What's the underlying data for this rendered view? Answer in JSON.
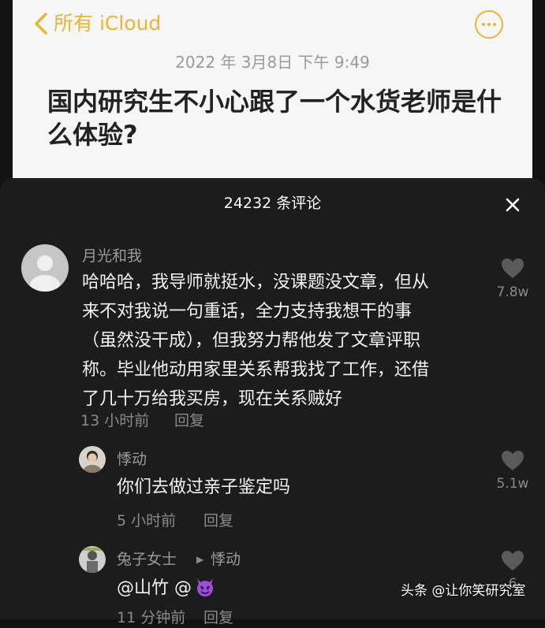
{
  "note": {
    "back_label": "所有 iCloud",
    "timestamp": "2022 年 3月8日  下午 9:49",
    "title": "国内研究生不小心跟了一个水货老师是什么体验?"
  },
  "comments_sheet": {
    "title": "24232 条评论"
  },
  "comments": [
    {
      "username": "月光和我",
      "text_lines": [
        "哈哈哈，我导师就挺水，没课题没文章，但从",
        "来不对我说一句重话，全力支持我想干的事",
        "（虽然没干成），但我努力帮他发了文章评职",
        "称。毕业他动用家里关系帮我找了工作，还借",
        "了几十万给我买房，现在关系贼好"
      ],
      "time": "13 小时前",
      "reply": "回复",
      "likes": "7.8w"
    },
    {
      "username": "悸动",
      "text": "你们去做过亲子鉴定吗",
      "time": "5 小时前",
      "reply": "回复",
      "likes": "5.1w"
    },
    {
      "username": "兔子女士",
      "reply_to": "悸动",
      "text": "@山竹 @",
      "emoji": "purple-devil-emoji",
      "likes": "6",
      "time_partial": "11 分钟前",
      "reply_partial": "回复"
    }
  ],
  "watermark": "头条 @让你笑研究室",
  "colors": {
    "accent": "#e6b53a",
    "sheet_bg": "#1c1c1c",
    "note_bg": "#f6f6f6"
  }
}
